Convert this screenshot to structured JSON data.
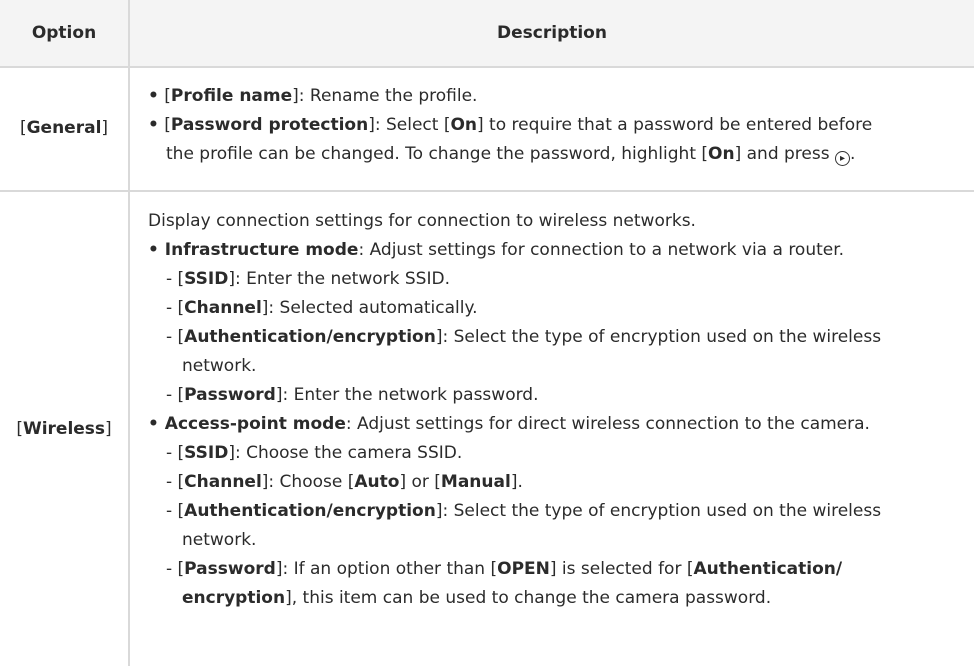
{
  "header": {
    "option": "Option",
    "description": "Description"
  },
  "general": {
    "option_open": "[",
    "option_label": "General",
    "option_close": "]",
    "items": [
      {
        "bullet": "•",
        "parts": [
          {
            "t": " [",
            "b": false
          },
          {
            "t": "Profile name",
            "b": true
          },
          {
            "t": "]: Rename the profile.",
            "b": false
          }
        ]
      },
      {
        "bullet": "•",
        "parts": [
          {
            "t": " [",
            "b": false
          },
          {
            "t": "Password protection",
            "b": true
          },
          {
            "t": "]: Select [",
            "b": false
          },
          {
            "t": "On",
            "b": true
          },
          {
            "t": "] to require that a password be entered before",
            "b": false
          }
        ]
      },
      {
        "bullet": "",
        "indent": true,
        "parts": [
          {
            "t": "the profile can be changed. To change the password, highlight [",
            "b": false
          },
          {
            "t": "On",
            "b": true
          },
          {
            "t": "] and press ",
            "b": false
          }
        ],
        "icon": "multi-selector-right-icon",
        "icon_glyph": "▸",
        "trail": "."
      }
    ]
  },
  "wireless": {
    "option_open": "[",
    "option_label": "Wireless",
    "option_close": "]",
    "lines": [
      {
        "level": 0,
        "parts": [
          {
            "t": "Display connection settings for connection to wireless networks.",
            "b": false
          }
        ]
      },
      {
        "level": 1,
        "bullet": "•",
        "parts": [
          {
            "t": "Infrastructure mode",
            "b": true
          },
          {
            "t": ": Adjust settings for connection to a network via a router.",
            "b": false
          }
        ]
      },
      {
        "level": 2,
        "parts": [
          {
            "t": "- [",
            "b": false
          },
          {
            "t": "SSID",
            "b": true
          },
          {
            "t": "]: Enter the network SSID.",
            "b": false
          }
        ]
      },
      {
        "level": 2,
        "parts": [
          {
            "t": "- [",
            "b": false
          },
          {
            "t": "Channel",
            "b": true
          },
          {
            "t": "]: Selected automatically.",
            "b": false
          }
        ]
      },
      {
        "level": 2,
        "parts": [
          {
            "t": "- [",
            "b": false
          },
          {
            "t": "Authentication/encryption",
            "b": true
          },
          {
            "t": "]: Select the type of encryption used on the wireless",
            "b": false
          }
        ]
      },
      {
        "level": 3,
        "parts": [
          {
            "t": "network.",
            "b": false
          }
        ]
      },
      {
        "level": 2,
        "parts": [
          {
            "t": "- [",
            "b": false
          },
          {
            "t": "Password",
            "b": true
          },
          {
            "t": "]: Enter the network password.",
            "b": false
          }
        ]
      },
      {
        "level": 1,
        "bullet": "•",
        "parts": [
          {
            "t": "Access-point mode",
            "b": true
          },
          {
            "t": ": Adjust settings for direct wireless connection to the camera.",
            "b": false
          }
        ]
      },
      {
        "level": 2,
        "parts": [
          {
            "t": "- [",
            "b": false
          },
          {
            "t": "SSID",
            "b": true
          },
          {
            "t": "]: Choose the camera SSID.",
            "b": false
          }
        ]
      },
      {
        "level": 2,
        "parts": [
          {
            "t": "- [",
            "b": false
          },
          {
            "t": "Channel",
            "b": true
          },
          {
            "t": "]: Choose [",
            "b": false
          },
          {
            "t": "Auto",
            "b": true
          },
          {
            "t": "] or [",
            "b": false
          },
          {
            "t": "Manual",
            "b": true
          },
          {
            "t": "].",
            "b": false
          }
        ]
      },
      {
        "level": 2,
        "parts": [
          {
            "t": "- [",
            "b": false
          },
          {
            "t": "Authentication/encryption",
            "b": true
          },
          {
            "t": "]: Select the type of encryption used on the wireless",
            "b": false
          }
        ]
      },
      {
        "level": 3,
        "parts": [
          {
            "t": "network.",
            "b": false
          }
        ]
      },
      {
        "level": 2,
        "parts": [
          {
            "t": "- [",
            "b": false
          },
          {
            "t": "Password",
            "b": true
          },
          {
            "t": "]: If an option other than [",
            "b": false
          },
          {
            "t": "OPEN",
            "b": true
          },
          {
            "t": "] is selected for [",
            "b": false
          },
          {
            "t": "Authentication/",
            "b": true
          }
        ]
      },
      {
        "level": 3,
        "parts": [
          {
            "t": "encryption",
            "b": true
          },
          {
            "t": "], this item can be used to change the camera password.",
            "b": false
          }
        ]
      }
    ]
  }
}
